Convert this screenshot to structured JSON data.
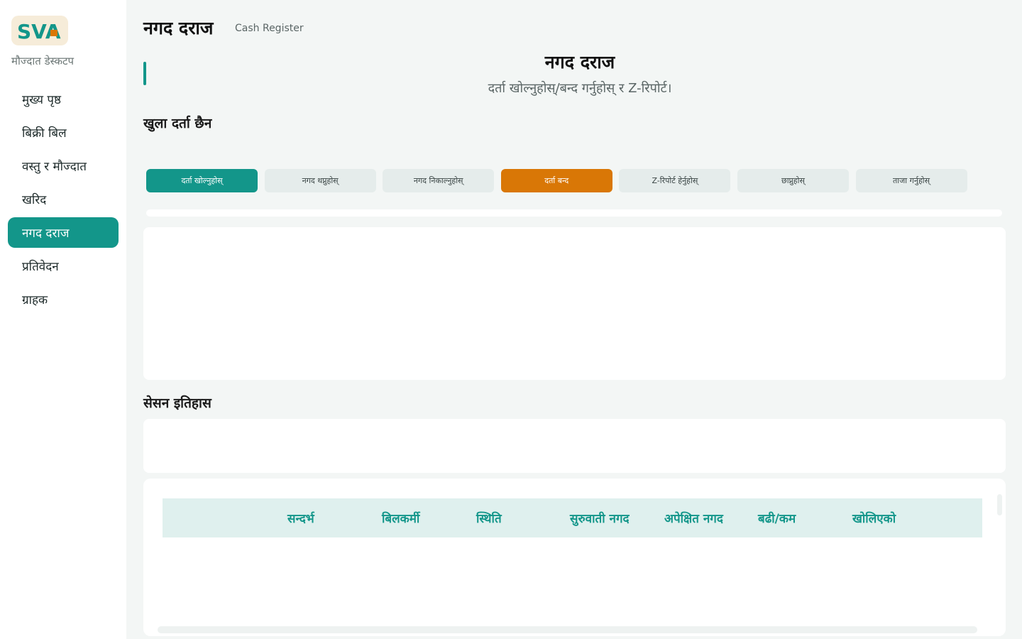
{
  "brand": {
    "logo_text": "SVA",
    "app_name": "मौज्दात डेस्कटप",
    "logo_colors": {
      "letters": "#13968a",
      "background": "#f6ecd9",
      "accent": "#d97706"
    }
  },
  "sidebar": {
    "items": [
      {
        "label": "मुख्य पृष्ठ",
        "active": false
      },
      {
        "label": "बिक्री बिल",
        "active": false
      },
      {
        "label": "वस्तु र मौज्दात",
        "active": false
      },
      {
        "label": "खरिद",
        "active": false
      },
      {
        "label": "नगद दराज",
        "active": true
      },
      {
        "label": "प्रतिवेदन",
        "active": false
      },
      {
        "label": "ग्राहक",
        "active": false
      }
    ]
  },
  "header": {
    "title": "नगद दराज",
    "subtitle": "Cash Register"
  },
  "hero": {
    "title": "नगद दराज",
    "subtitle": "दर्ता खोल्नुहोस्/बन्द गर्नुहोस् र Z-रिपोर्ट।"
  },
  "status": "खुला दर्ता छैन",
  "actions": [
    {
      "label": "दर्ता खोल्नुहोस्",
      "style": "primary"
    },
    {
      "label": "नगद थप्नुहोस्",
      "style": "default"
    },
    {
      "label": "नगद निकाल्नुहोस्",
      "style": "default"
    },
    {
      "label": "दर्ता बन्द",
      "style": "warning"
    },
    {
      "label": "Z-रिपोर्ट हेर्नुहोस्",
      "style": "default"
    },
    {
      "label": "छाप्नुहोस्",
      "style": "default"
    },
    {
      "label": "ताजा गर्नुहोस्",
      "style": "default"
    }
  ],
  "history": {
    "title": "सेसन इतिहास",
    "columns": [
      "सन्दर्भ",
      "बिलकर्मी",
      "स्थिति",
      "सुरुवाती नगद",
      "अपेक्षित नगद",
      "बढी/कम",
      "खोलिएको"
    ],
    "rows": []
  },
  "colors": {
    "accent": "#13968a",
    "warning": "#d97706",
    "background": "#f3f6f5",
    "table_header_bg": "#dff0ee"
  }
}
